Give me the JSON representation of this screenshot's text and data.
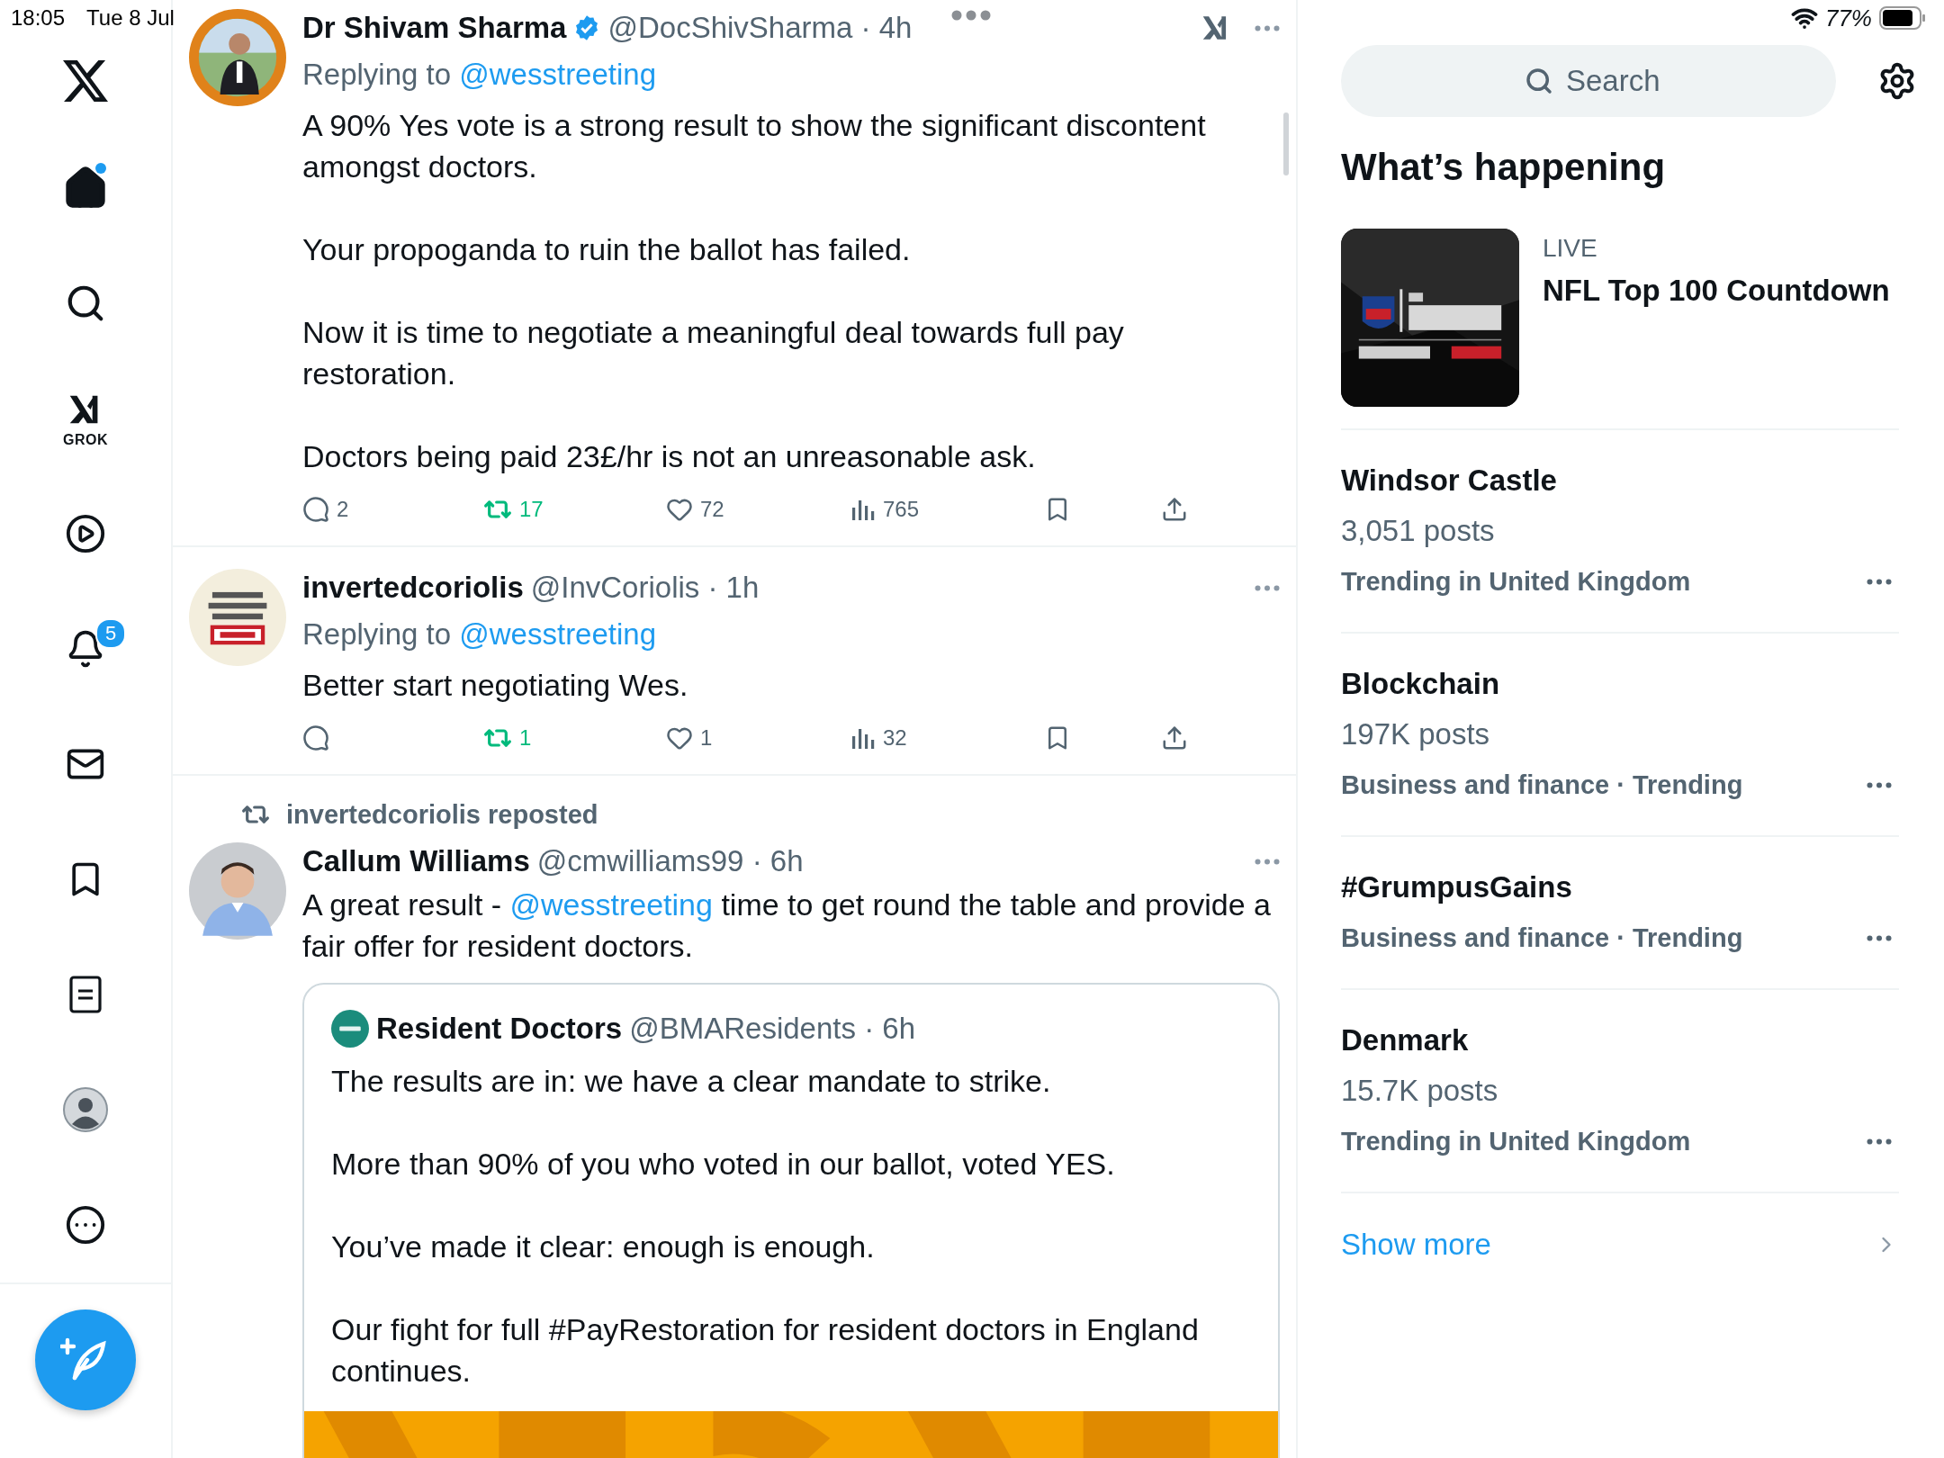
{
  "status_bar": {
    "time": "18:05",
    "date": "Tue 8 Jul",
    "battery": "77%"
  },
  "sidebar": {
    "items": [
      {
        "kind": "logo"
      },
      {
        "kind": "home",
        "selected": true,
        "unread": true
      },
      {
        "kind": "explore",
        "selected": false
      },
      {
        "kind": "grok",
        "label": "GROK",
        "selected": false
      },
      {
        "kind": "video",
        "selected": false
      },
      {
        "kind": "notifications",
        "badge": "5",
        "selected": false
      },
      {
        "kind": "messages",
        "selected": false
      },
      {
        "kind": "bookmarks",
        "selected": false
      },
      {
        "kind": "lists",
        "selected": false
      },
      {
        "kind": "profile",
        "selected": false
      },
      {
        "kind": "more",
        "selected": false
      }
    ]
  },
  "posts": [
    {
      "kind": "reply",
      "name": "Dr Shivam Sharma",
      "verified": true,
      "handle_time": "@DocShivSharma · 4h",
      "grok": true,
      "replying_prefix": "Replying to",
      "replying_to": "@wesstreeting",
      "paragraphs": [
        "A 90% Yes vote is a strong result to show the significant discontent amongst doctors.",
        "Your propoganda to ruin the ballot has failed.",
        "Now it is time to negotiate a meaningful deal towards full pay restoration.",
        "Doctors being paid 23£/hr is not an unreasonable ask."
      ],
      "actions": {
        "replies": "2",
        "reposts": "17",
        "likes": "72",
        "views": "765",
        "reposted": true
      }
    },
    {
      "kind": "reply",
      "name": "invertedcoriolis",
      "verified": false,
      "handle_time": "@InvCoriolis · 1h",
      "grok": false,
      "replying_prefix": "Replying to",
      "replying_to": "@wesstreeting",
      "paragraphs": [
        "Better start negotiating Wes."
      ],
      "actions": {
        "reposts": "1",
        "likes": "1",
        "views": "32",
        "reposted": true
      }
    },
    {
      "kind": "repost",
      "reposted_by": "invertedcoriolis reposted",
      "name": "Callum Williams",
      "verified": false,
      "handle_time": "@cmwilliams99 · 6h",
      "grok": false,
      "paragraphs": [
        [
          {
            "text": "A great result - "
          },
          {
            "link": "@wesstreeting"
          },
          {
            "text": " time to get round the table and provide a fair offer for resident doctors."
          }
        ]
      ],
      "quote": {
        "name": "Resident Doctors",
        "handle_time": "@BMAResidents · 6h",
        "paragraphs": [
          "The results are in: we have a clear mandate to strike.",
          "More than 90% of you who voted in our ballot, voted YES.",
          "You’ve made it clear: enough is enough.",
          "Our fight for full #PayRestoration for resident doctors in England continues."
        ],
        "media": {
          "kind": "picture"
        }
      }
    }
  ],
  "search": {
    "placeholder": "Search"
  },
  "trends": {
    "title": "What’s happening",
    "items": [
      {
        "kind": "event",
        "label": "LIVE",
        "title": "NFL Top 100 Countdown"
      },
      {
        "kind": "trend",
        "name": "Windsor Castle",
        "posts": "3,051 posts",
        "context": "Trending in United Kingdom"
      },
      {
        "kind": "trend",
        "name": "Blockchain",
        "posts": "197K posts",
        "context": "Business and finance · Trending"
      },
      {
        "kind": "trend",
        "name": "#GrumpusGains",
        "context": "Business and finance · Trending"
      },
      {
        "kind": "trend",
        "name": "Denmark",
        "posts": "15.7K posts",
        "context": "Trending in United Kingdom"
      }
    ],
    "show_more": "Show more"
  }
}
